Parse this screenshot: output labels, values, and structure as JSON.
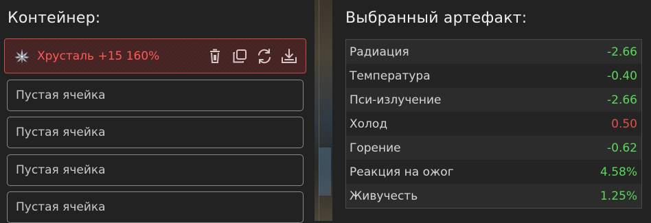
{
  "container": {
    "title": "Контейнер:",
    "selected_slot": {
      "icon": "crystal-artifact-icon",
      "label": "Хрусталь +15 160%",
      "actions": [
        "trash-icon",
        "copy-icon",
        "swap-icon",
        "download-icon"
      ]
    },
    "empty_slots": [
      {
        "label": "Пустая ячейка"
      },
      {
        "label": "Пустая ячейка"
      },
      {
        "label": "Пустая ячейка"
      },
      {
        "label": "Пустая ячейка"
      }
    ]
  },
  "artifact": {
    "title": "Выбранный артефакт:",
    "stats": [
      {
        "name": "Радиация",
        "value": "-2.66",
        "status": "positive"
      },
      {
        "name": "Температура",
        "value": "-0.40",
        "status": "positive"
      },
      {
        "name": "Пси-излучение",
        "value": "-2.66",
        "status": "positive"
      },
      {
        "name": "Холод",
        "value": "0.50",
        "status": "negative"
      },
      {
        "name": "Горение",
        "value": "-0.62",
        "status": "positive"
      },
      {
        "name": "Реакция на ожог",
        "value": "4.58%",
        "status": "positive"
      },
      {
        "name": "Живучесть",
        "value": "1.25%",
        "status": "positive"
      }
    ]
  },
  "colors": {
    "positive": "#5cd65c",
    "negative": "#e0504c",
    "selected_border": "#d04a47",
    "selected_text": "#ff5a55"
  }
}
